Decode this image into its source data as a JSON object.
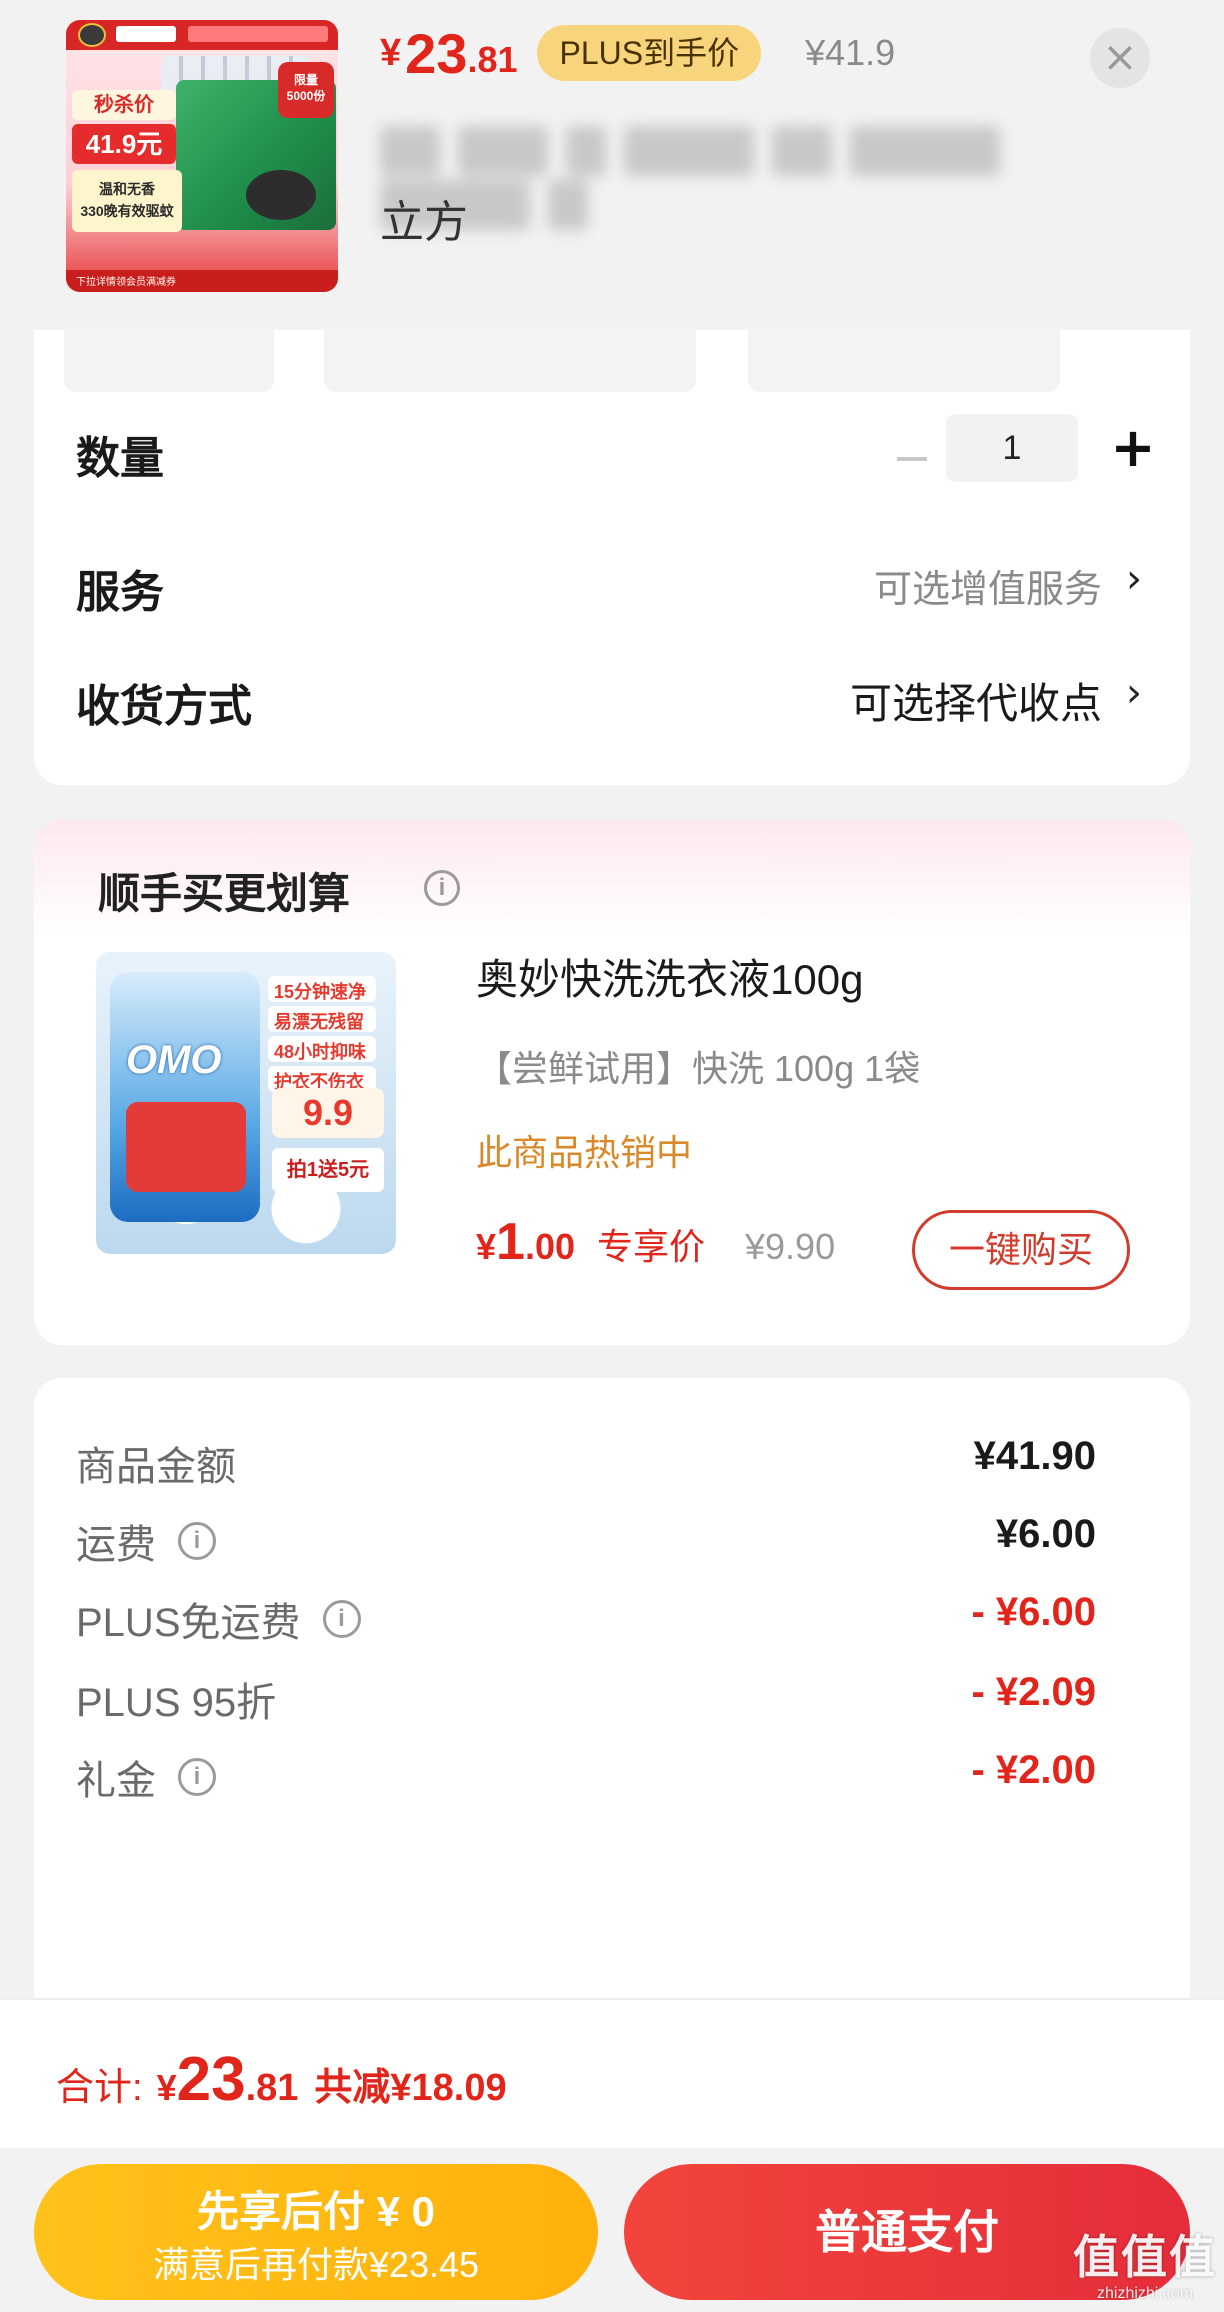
{
  "header": {
    "price_currency": "¥",
    "price_integer": "23",
    "price_decimal": ".81",
    "plus_badge": "PLUS到手价",
    "original_price": "¥41.9",
    "close_icon": "close-icon",
    "title_line2": "立方",
    "thumbnail": {
      "sale_label": "秒杀价",
      "sale_price": "41.9元",
      "limit_label": "限量\n5000份",
      "desc_label": "温和无香\n330晚有效驱蚊",
      "footer_text": "下拉详情领会员满减券"
    }
  },
  "options": {
    "quantity_label": "数量",
    "quantity_value": "1",
    "minus_icon": "minus-icon",
    "plus_icon": "plus-icon",
    "service_label": "服务",
    "service_value": "可选增值服务",
    "delivery_label": "收货方式",
    "delivery_value": "可选择代收点",
    "chevron": "›"
  },
  "addon": {
    "section_title": "顺手买更划算",
    "info_glyph": "i",
    "name": "奥妙快洗洗衣液100g",
    "spec": "【尝鲜试用】快洗 100g 1袋",
    "hot_text": "此商品热销中",
    "price_currency": "¥",
    "price_integer": "1",
    "price_decimal": ".00",
    "exclusive_label": "专享价",
    "original_price": "¥9.90",
    "buy_button": "一键购买",
    "image_text": {
      "logo": "OMO",
      "feature_1": "15分钟速净",
      "feature_2": "易漂无残留",
      "feature_3": "48小时抑味",
      "feature_4": "护衣不伤衣",
      "price_badge": "9.9",
      "gift": "拍1送5元"
    }
  },
  "breakdown": {
    "rows": [
      {
        "label": "商品金额",
        "value": "¥41.90",
        "info": false,
        "red": false
      },
      {
        "label": "运费",
        "value": "¥6.00",
        "info": true,
        "red": false
      },
      {
        "label": "PLUS免运费",
        "value": "- ¥6.00",
        "info": true,
        "red": true
      },
      {
        "label": "PLUS 95折",
        "value": "- ¥2.09",
        "info": false,
        "red": true
      },
      {
        "label": "礼金",
        "value": "- ¥2.00",
        "info": true,
        "red": true
      }
    ]
  },
  "total": {
    "label": "合计:",
    "currency": "¥",
    "integer": "23",
    "decimal": ".81",
    "saved": "共减¥18.09"
  },
  "actions": {
    "later_title": "先享后付 ¥ 0",
    "later_subtitle": "满意后再付款¥23.45",
    "pay_button": "普通支付"
  },
  "watermark": {
    "big": "值值值",
    "small": "zhizhizhi.com"
  },
  "colors": {
    "accent_red": "#e1251b",
    "plus_gold": "#f8d57d",
    "later_yellow": "#ffb10d",
    "hot_orange": "#d88a2a"
  }
}
